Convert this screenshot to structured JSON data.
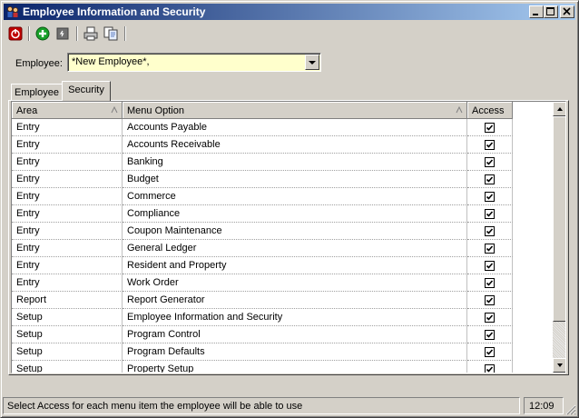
{
  "window": {
    "title": "Employee Information and Security"
  },
  "toolbar": {
    "icons": [
      "power-icon",
      "add-icon",
      "delete-icon",
      "print-icon",
      "copy-icon"
    ]
  },
  "employee": {
    "label": "Employee:",
    "value": "*New Employee*,"
  },
  "tabs": [
    {
      "label": "Employee"
    },
    {
      "label": "Security"
    }
  ],
  "grid": {
    "columns": {
      "area": "Area",
      "menu_option": "Menu Option",
      "access": "Access"
    },
    "rows": [
      {
        "area": "Entry",
        "menu_option": "Accounts Payable",
        "access": true
      },
      {
        "area": "Entry",
        "menu_option": "Accounts Receivable",
        "access": true
      },
      {
        "area": "Entry",
        "menu_option": "Banking",
        "access": true
      },
      {
        "area": "Entry",
        "menu_option": "Budget",
        "access": true
      },
      {
        "area": "Entry",
        "menu_option": "Commerce",
        "access": true
      },
      {
        "area": "Entry",
        "menu_option": "Compliance",
        "access": true
      },
      {
        "area": "Entry",
        "menu_option": "Coupon Maintenance",
        "access": true
      },
      {
        "area": "Entry",
        "menu_option": "General Ledger",
        "access": true
      },
      {
        "area": "Entry",
        "menu_option": "Resident and Property",
        "access": true
      },
      {
        "area": "Entry",
        "menu_option": "Work Order",
        "access": true
      },
      {
        "area": "Report",
        "menu_option": "Report Generator",
        "access": true
      },
      {
        "area": "Setup",
        "menu_option": "Employee Information and Security",
        "access": true
      },
      {
        "area": "Setup",
        "menu_option": "Program Control",
        "access": true
      },
      {
        "area": "Setup",
        "menu_option": "Program Defaults",
        "access": true
      },
      {
        "area": "Setup",
        "menu_option": "Property Setup",
        "access": true
      }
    ]
  },
  "status": {
    "message": "Select Access for each menu item the employee will be able to use",
    "time": "12:09"
  },
  "colors": {
    "titlebar_start": "#0a246a",
    "titlebar_end": "#a6caf0",
    "combo_bg": "#ffffcc",
    "face": "#d4d0c8"
  }
}
